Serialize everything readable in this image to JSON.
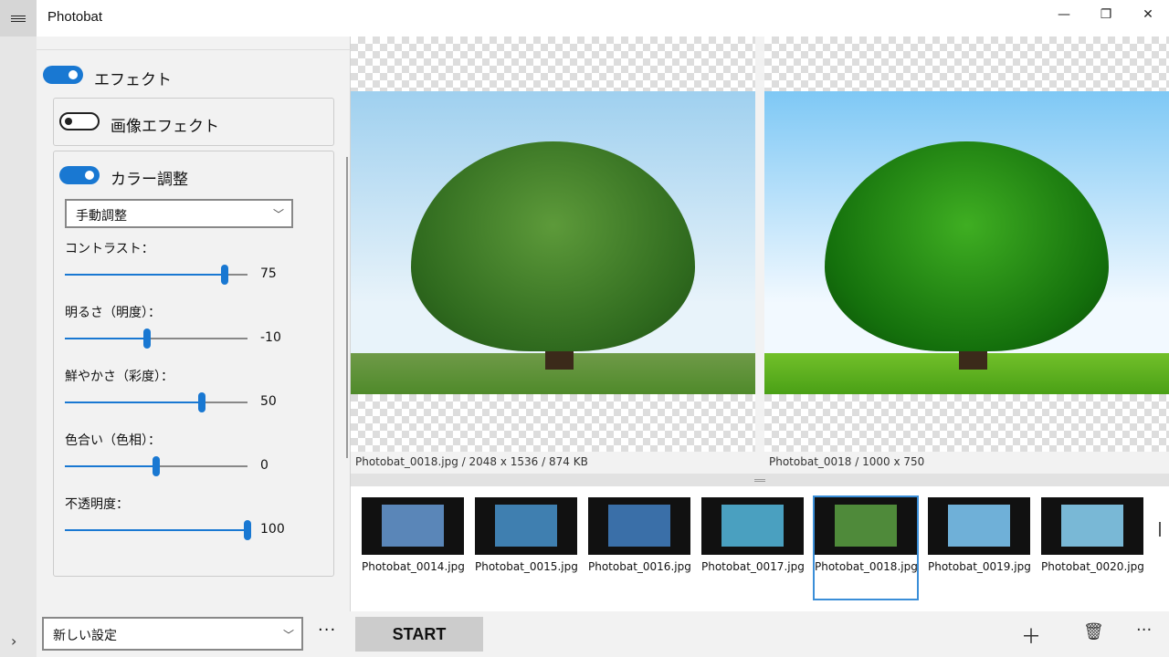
{
  "app": {
    "title": "Photobat"
  },
  "window": {
    "minimize": "—",
    "restore": "❐",
    "close": "✕"
  },
  "effects": {
    "effect_label": "エフェクト",
    "effect_on": true,
    "image_effect_label": "画像エフェクト",
    "image_effect_on": false,
    "color_adjust_label": "カラー調整",
    "color_adjust_on": true,
    "mode_value": "手動調整",
    "sliders": [
      {
        "label": "コントラスト：",
        "value": "75",
        "min": -100,
        "max": 100,
        "num": 75
      },
      {
        "label": "明るさ（明度）：",
        "value": "-10",
        "min": -100,
        "max": 100,
        "num": -10
      },
      {
        "label": "鮮やかさ（彩度）：",
        "value": "50",
        "min": -100,
        "max": 100,
        "num": 50
      },
      {
        "label": "色合い（色相）：",
        "value": "0",
        "min": -180,
        "max": 180,
        "num": 0
      },
      {
        "label": "不透明度：",
        "value": "100",
        "min": 0,
        "max": 100,
        "num": 100
      }
    ]
  },
  "preview": {
    "original_info": "Photobat_0018.jpg / 2048 x 1536 / 874 KB",
    "result_info": "Photobat_0018 / 1000 x 750"
  },
  "thumbnails": [
    {
      "name": "Photobat_0014.jpg",
      "color": "#5a86b8"
    },
    {
      "name": "Photobat_0015.jpg",
      "color": "#3f7fb0"
    },
    {
      "name": "Photobat_0016.jpg",
      "color": "#3a6fa8"
    },
    {
      "name": "Photobat_0017.jpg",
      "color": "#4aa0c0"
    },
    {
      "name": "Photobat_0018.jpg",
      "color": "#4f8a3a",
      "selected": true
    },
    {
      "name": "Photobat_0019.jpg",
      "color": "#6fb0d8"
    },
    {
      "name": "Photobat_0020.jpg",
      "color": "#79b8d6"
    }
  ],
  "bottom": {
    "preset_value": "新しい設定",
    "more_dots": "···",
    "start_label": "START",
    "add_icon": "＋",
    "delete_icon": "🗑",
    "overflow_dots": "···"
  },
  "accent": "#1978d2"
}
